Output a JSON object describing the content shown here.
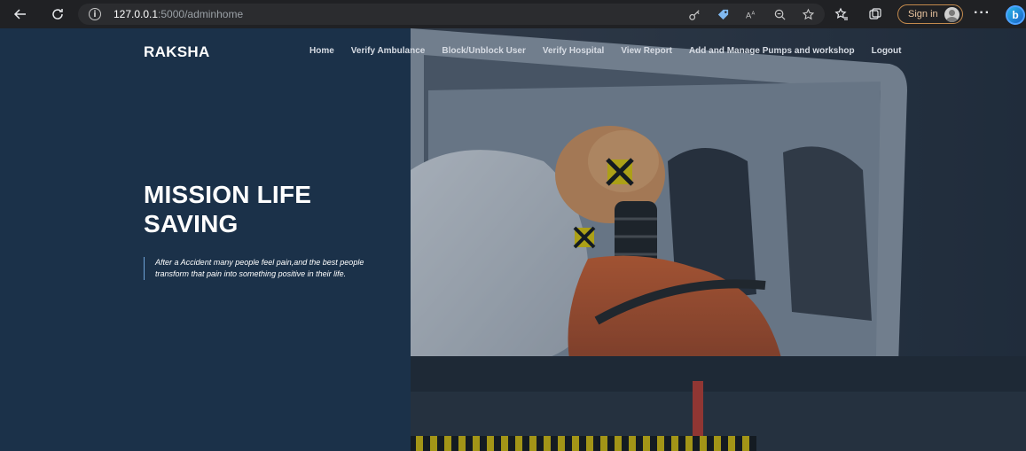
{
  "browser": {
    "url_host": "127.0.0.1",
    "url_path": ":5000/adminhome",
    "signin_label": "Sign in",
    "more_label": "···",
    "bing_label": "b"
  },
  "site": {
    "brand": "RAKSHA",
    "nav": [
      {
        "label": "Home"
      },
      {
        "label": "Verify Ambulance"
      },
      {
        "label": "Block/Unblock User"
      },
      {
        "label": "Verify Hospital"
      },
      {
        "label": "View Report"
      },
      {
        "label": "Add and Manage Pumps and workshop"
      },
      {
        "label": "Logout"
      }
    ]
  },
  "hero": {
    "title": "MISSION LIFE SAVING",
    "quote": "After a Accident many people feel pain,and the best people transform that pain into something positive in their life."
  },
  "colors": {
    "page_bg": "#1b3149",
    "browser_bg": "#202124",
    "accent_border": "#6ea3d8"
  }
}
